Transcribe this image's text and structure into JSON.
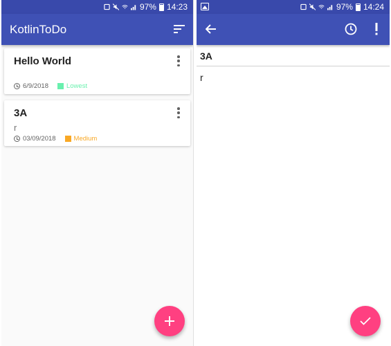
{
  "left_screen": {
    "status_bar": {
      "battery": "97%",
      "time": "14:23"
    },
    "app_bar": {
      "title": "KotlinToDo",
      "sort_icon": "sort-icon"
    },
    "todos": [
      {
        "title": "Hello World",
        "body": "",
        "date": "6/9/2018",
        "priority": "Lowest",
        "priority_color": "#69f0ae",
        "menu_icon": "more-vert-icon"
      },
      {
        "title": "3A",
        "body": "r",
        "date": "03/09/2018",
        "priority": "Medium",
        "priority_color": "#f9a825",
        "menu_icon": "more-vert-icon"
      }
    ],
    "fab": {
      "icon": "add-icon",
      "color": "#ff4081"
    }
  },
  "right_screen": {
    "status_bar": {
      "battery": "97%",
      "time": "14:24"
    },
    "app_bar": {
      "back_icon": "arrow-back-icon",
      "clock_icon": "clock-icon",
      "priority_icon": "exclamation-icon"
    },
    "editor": {
      "title": "3A",
      "body": "r"
    },
    "fab": {
      "icon": "check-icon",
      "color": "#ff4081"
    }
  },
  "colors": {
    "primary": "#3f51b5",
    "primary_dark": "#3949ab",
    "accent": "#ff4081"
  }
}
